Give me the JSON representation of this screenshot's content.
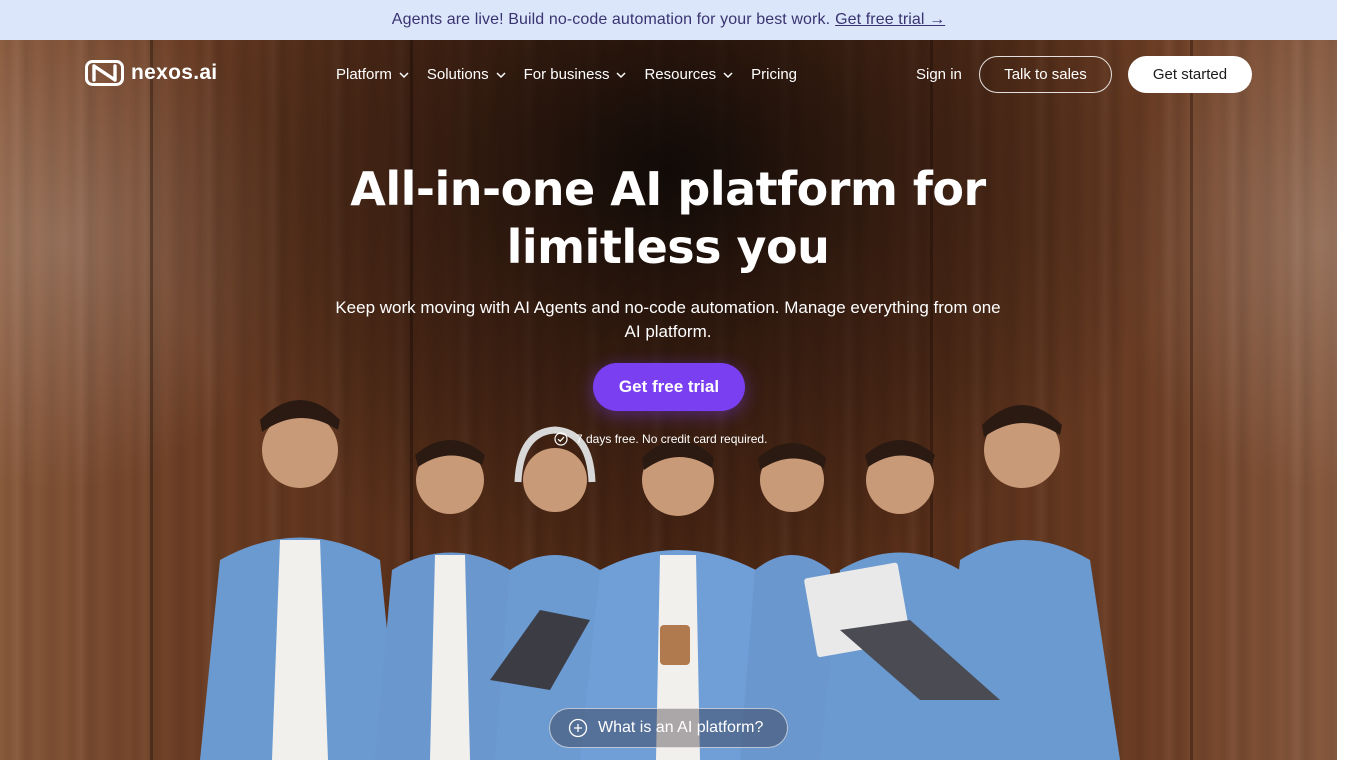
{
  "announcement": {
    "text": "Agents are live! Build no-code automation for your best work.",
    "link": "Get free trial →"
  },
  "nav": {
    "logo_text": "nexos.ai",
    "items": [
      {
        "label": "Platform",
        "has_dropdown": true
      },
      {
        "label": "Solutions",
        "has_dropdown": true
      },
      {
        "label": "For business",
        "has_dropdown": true
      },
      {
        "label": "Resources",
        "has_dropdown": true
      },
      {
        "label": "Pricing",
        "has_dropdown": false
      }
    ],
    "sign_in": "Sign in",
    "talk_to_sales": "Talk to sales",
    "get_started": "Get started"
  },
  "hero": {
    "headline_line1": "All-in-one AI platform for",
    "headline_line2": "limitless you",
    "subtitle_line1": "Keep work moving with AI Agents and no-code automation. Manage everything from one",
    "subtitle_line2": "AI platform.",
    "cta": "Get free trial",
    "note": "7 days free. No credit card required.",
    "what_is": "What is an AI platform?"
  },
  "colors": {
    "announcement_bg": "#dbe6fb",
    "announcement_text": "#3a3470",
    "cta_purple": "#7b3ff2",
    "shirt_blue": "#6b9ad0"
  },
  "icons": {
    "logo": "nexos-logo-icon",
    "chevron": "chevron-down-icon",
    "check": "check-circle-icon",
    "plus": "plus-circle-icon"
  }
}
